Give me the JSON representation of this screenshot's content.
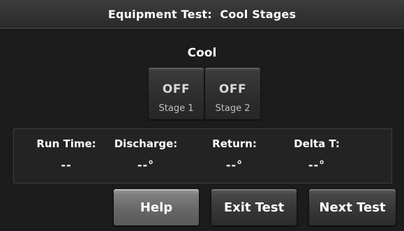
{
  "header": {
    "title": "Equipment Test:  Cool Stages"
  },
  "section": {
    "label": "Cool"
  },
  "stages": [
    {
      "state": "OFF",
      "name": "Stage 1"
    },
    {
      "state": "OFF",
      "name": "Stage 2"
    }
  ],
  "readouts": {
    "run_time": {
      "label": "Run Time:",
      "value": "--"
    },
    "discharge": {
      "label": "Discharge:",
      "value": "--°"
    },
    "return": {
      "label": "Return:",
      "value": "--°"
    },
    "delta_t": {
      "label": "Delta T:",
      "value": "--°"
    }
  },
  "buttons": {
    "help": "Help",
    "exit": "Exit Test",
    "next": "Next Test"
  }
}
